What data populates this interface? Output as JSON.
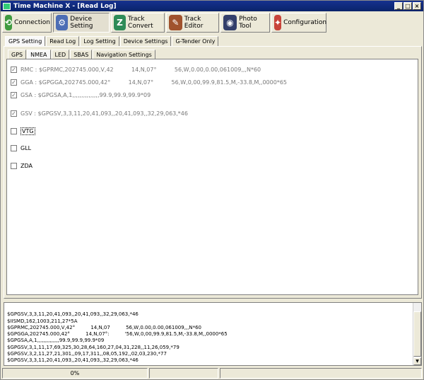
{
  "window": {
    "title": "Time Machine X - [Read Log]"
  },
  "toolbar": {
    "buttons": [
      {
        "label": "Connection",
        "color": "#3f9a3f"
      },
      {
        "label": "Device Setting",
        "color": "#4c6db5"
      },
      {
        "label": "Track Convert",
        "color": "#2e8b57"
      },
      {
        "label": "Track Editor",
        "color": "#a0522d"
      },
      {
        "label": "Photo Tool",
        "color": "#333f6b"
      },
      {
        "label": "Configuration",
        "color": "#c8443a"
      }
    ]
  },
  "main_tabs": [
    "GPS Setting",
    "Read Log",
    "Log Setting",
    "Device Settings",
    "G-Tender Only"
  ],
  "sub_tabs": [
    "GPS",
    "NMEA",
    "LED",
    "SBAS",
    "Navigation Settings"
  ],
  "options": [
    {
      "label": "RMC : $GPRMC,202745.000,V,42          14,N,07°          56,W,0.00,0.00,061009,,,N*60",
      "checked": true
    },
    {
      "label": "GGA : $GPGGA,202745.000,42°          14,N,07°          56,W,0,00,99.9,81.5,M,-33.8,M,,0000*65",
      "checked": true
    },
    {
      "label": "GSA : $GPGSA,A,1,,,,,,,,,,,,,,,99.9,99.9,99.9*09",
      "checked": true
    },
    {
      "label": "GSV : $GPGSV,3,3,11,20,41,093,,20,41,093,,32,29,063,*46",
      "checked": true
    },
    {
      "label": "VTG",
      "checked": false
    },
    {
      "label": "GLL",
      "checked": false
    },
    {
      "label": "ZDA",
      "checked": false
    }
  ],
  "log_lines": [
    "$GPGSV,3,3,11,20,41,093,,20,41,093,,32,29,063,*46",
    "$IISMD,162,1003,211,27*5A",
    "$GPRMC,202745.000,V,42°          14,N,07          56,W,0.00,0.00,061009,,,N*60",
    "$GPGGA,202745.000,42°          14,N,07°:          '56,W,0,00,99.9,81.5,M,-33.8,M,,0000*65",
    "$GPGSA,A,1,,,,,,,,,,,,,,99.9,99.9,99.9*09",
    "$GPGSV,3,1,11,17,69,325,30,28,64,160,27,04,31,228,,11,26,059,*79",
    "$GPGSV,3,2,11,27,21,301,,09,17,311,,08,05,192,,02,03,230,*77",
    "$GPGSV,3,3,11,20,41,093,,20,41,093,,32,29,063,*46"
  ],
  "status": {
    "progress": "0%"
  }
}
